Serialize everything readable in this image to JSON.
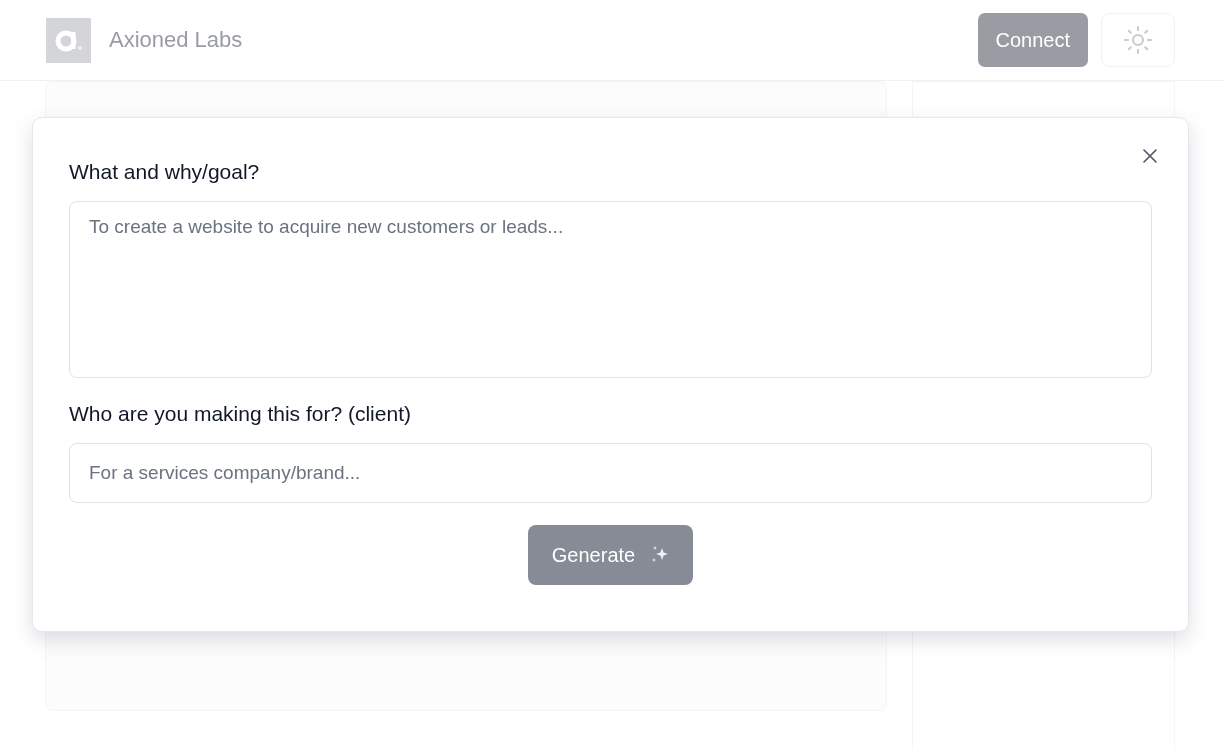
{
  "header": {
    "brand": "Axioned Labs",
    "connect_button": "Connect"
  },
  "modal": {
    "fields": [
      {
        "kind": "textarea",
        "label": "What and why/goal?",
        "placeholder": "To create a website to acquire new customers or leads..."
      },
      {
        "kind": "input",
        "label": "Who are you making this for? (client)",
        "placeholder": "For a services company/brand..."
      }
    ],
    "generate_button": "Generate"
  }
}
